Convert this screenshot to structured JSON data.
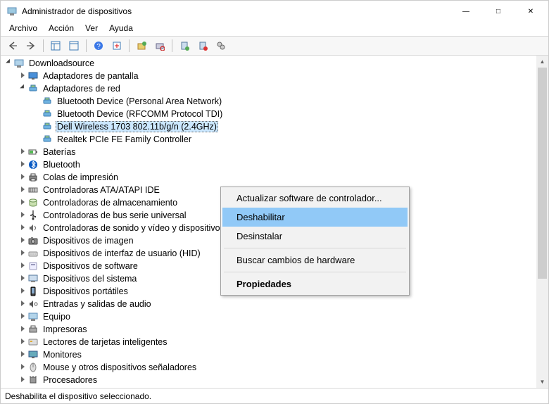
{
  "window": {
    "title": "Administrador de dispositivos"
  },
  "menubar": {
    "items": [
      "Archivo",
      "Acción",
      "Ver",
      "Ayuda"
    ]
  },
  "toolbar": {
    "buttons": [
      "back",
      "forward",
      "show-hide-tree",
      "show-hide-panel",
      "help",
      "action",
      "update",
      "scan",
      "uninstall",
      "disable",
      "properties"
    ]
  },
  "tree": {
    "root": {
      "label": "Downloadsource",
      "icon": "computer"
    },
    "nodes": [
      {
        "label": "Adaptadores de pantalla",
        "icon": "display",
        "state": "collapsed",
        "indent": 1
      },
      {
        "label": "Adaptadores de red",
        "icon": "network",
        "state": "expanded",
        "indent": 1
      },
      {
        "label": "Bluetooth Device (Personal Area Network)",
        "icon": "network",
        "indent": 2
      },
      {
        "label": "Bluetooth Device (RFCOMM Protocol TDI)",
        "icon": "network",
        "indent": 2
      },
      {
        "label": "Dell Wireless 1703 802.11b/g/n (2.4GHz)",
        "icon": "network",
        "indent": 2,
        "selected": true
      },
      {
        "label": "Realtek PCIe FE Family Controller",
        "icon": "network",
        "indent": 2
      },
      {
        "label": "Baterías",
        "icon": "battery",
        "state": "collapsed",
        "indent": 1
      },
      {
        "label": "Bluetooth",
        "icon": "bluetooth",
        "state": "collapsed",
        "indent": 1
      },
      {
        "label": "Colas de impresión",
        "icon": "printer",
        "state": "collapsed",
        "indent": 1
      },
      {
        "label": "Controladoras ATA/ATAPI IDE",
        "icon": "ide",
        "state": "collapsed",
        "indent": 1
      },
      {
        "label": "Controladoras de almacenamiento",
        "icon": "storage",
        "state": "collapsed",
        "indent": 1
      },
      {
        "label": "Controladoras de bus serie universal",
        "icon": "usb",
        "state": "collapsed",
        "indent": 1
      },
      {
        "label": "Controladoras de sonido y vídeo y dispositivos de juego",
        "icon": "sound",
        "state": "collapsed",
        "indent": 1
      },
      {
        "label": "Dispositivos de imagen",
        "icon": "camera",
        "state": "collapsed",
        "indent": 1
      },
      {
        "label": "Dispositivos de interfaz de usuario (HID)",
        "icon": "hid",
        "state": "collapsed",
        "indent": 1
      },
      {
        "label": "Dispositivos de software",
        "icon": "software",
        "state": "collapsed",
        "indent": 1
      },
      {
        "label": "Dispositivos del sistema",
        "icon": "system",
        "state": "collapsed",
        "indent": 1
      },
      {
        "label": "Dispositivos portátiles",
        "icon": "portable",
        "state": "collapsed",
        "indent": 1
      },
      {
        "label": "Entradas y salidas de audio",
        "icon": "audio",
        "state": "collapsed",
        "indent": 1
      },
      {
        "label": "Equipo",
        "icon": "computer",
        "state": "collapsed",
        "indent": 1
      },
      {
        "label": "Impresoras",
        "icon": "printer2",
        "state": "collapsed",
        "indent": 1
      },
      {
        "label": "Lectores de tarjetas inteligentes",
        "icon": "smartcard",
        "state": "collapsed",
        "indent": 1
      },
      {
        "label": "Monitores",
        "icon": "monitor",
        "state": "collapsed",
        "indent": 1
      },
      {
        "label": "Mouse y otros dispositivos señaladores",
        "icon": "mouse",
        "state": "collapsed",
        "indent": 1
      },
      {
        "label": "Procesadores",
        "icon": "cpu",
        "state": "collapsed",
        "indent": 1
      }
    ]
  },
  "contextmenu": {
    "items": [
      {
        "label": "Actualizar software de controlador..."
      },
      {
        "label": "Deshabilitar",
        "highlighted": true
      },
      {
        "label": "Desinstalar"
      },
      {
        "sep": true
      },
      {
        "label": "Buscar cambios de hardware"
      },
      {
        "sep": true
      },
      {
        "label": "Propiedades",
        "bold": true
      }
    ]
  },
  "statusbar": {
    "text": "Deshabilita el dispositivo seleccionado."
  }
}
